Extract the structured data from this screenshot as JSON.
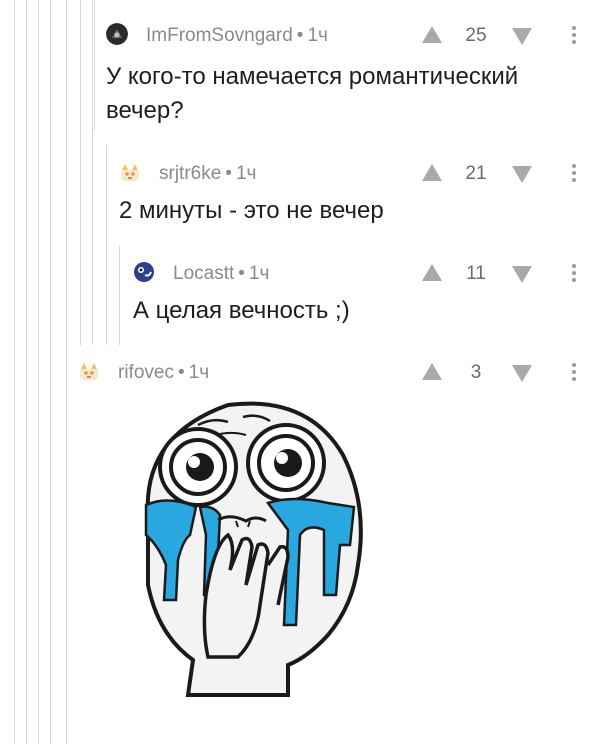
{
  "comments": [
    {
      "author": "ImFromSovngard",
      "separator": "•",
      "time": "1ч",
      "votes": "25",
      "text": "У кого-то намечается романтический вечер?",
      "avatar_icon": "dark-round-avatar-icon"
    },
    {
      "author": "srjtr6ke",
      "separator": "•",
      "time": "1ч",
      "votes": "21",
      "text": "2 минуты - это не вечер",
      "avatar_icon": "default-cat-avatar-icon"
    },
    {
      "author": "Locastt",
      "separator": "•",
      "time": "1ч",
      "votes": "11",
      "text": "А целая вечность ;)",
      "avatar_icon": "blue-mascot-avatar-icon"
    },
    {
      "author": "rifovec",
      "separator": "•",
      "time": "1ч",
      "votes": "3",
      "text": "",
      "avatar_icon": "default-cat-avatar-icon"
    }
  ],
  "image": {
    "subject": "crying-face-meme"
  },
  "colors": {
    "thread_line": "#d6d6d6",
    "meta_text": "#8a8a8a",
    "vote_arrow": "#a9a9a9",
    "tears": "#29a8e0"
  }
}
